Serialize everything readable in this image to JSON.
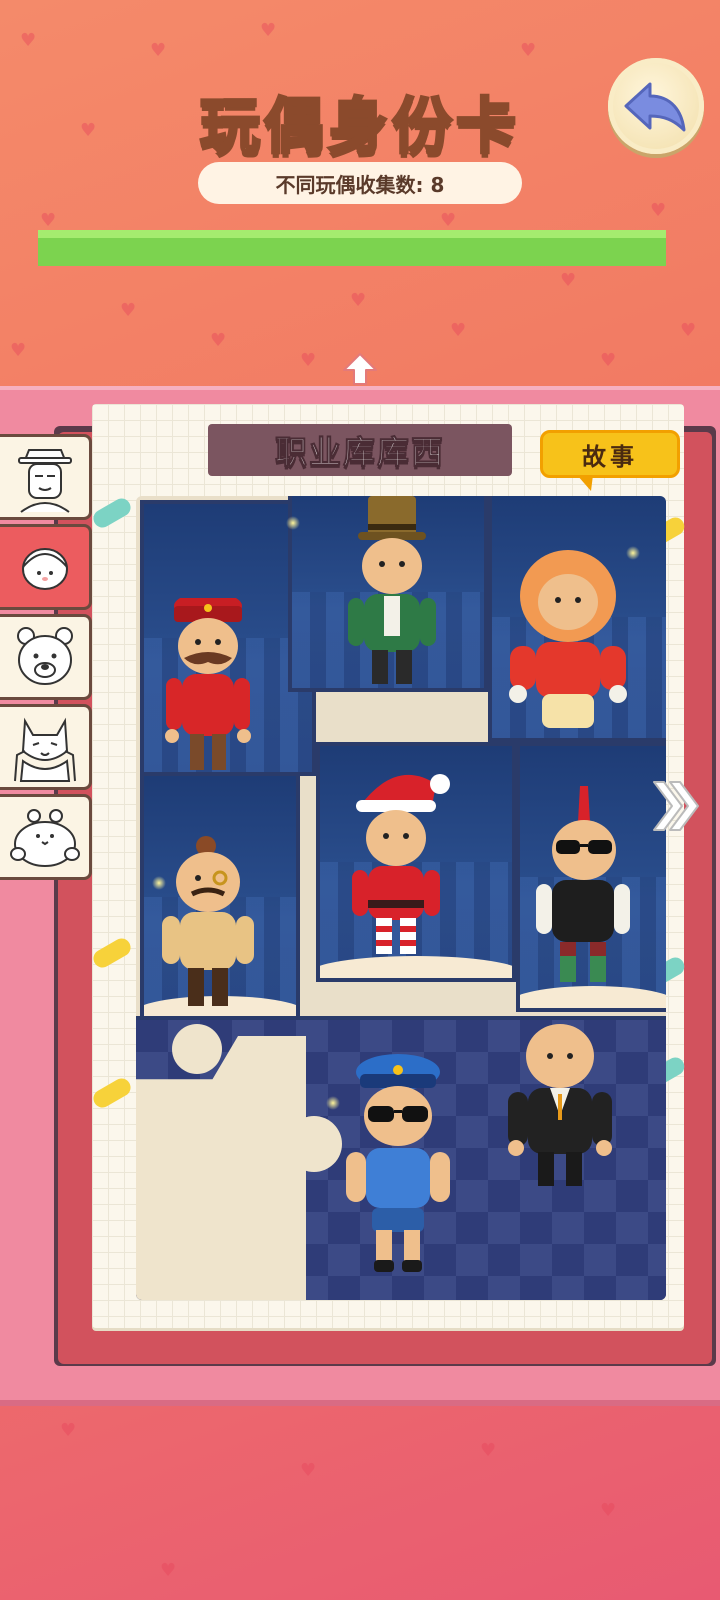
{
  "header": {
    "title_part1": "玩偶",
    "title_part2": "身份卡",
    "collection_label": "不同玩偶收集数: 8",
    "progress_fraction": 1.0
  },
  "card": {
    "name": "职业库库西",
    "story_button": "故事"
  },
  "side_tabs": [
    {
      "icon": "old-man-icon",
      "active": false
    },
    {
      "icon": "bald-head-icon",
      "active": true
    },
    {
      "icon": "polar-bear-icon",
      "active": false
    },
    {
      "icon": "cat-icon",
      "active": false
    },
    {
      "icon": "hamster-icon",
      "active": false
    }
  ],
  "dolls": [
    {
      "id": "conductor",
      "hat": "#c81e24",
      "body": "#d82628"
    },
    {
      "id": "top-hat-gentleman",
      "hat": "#8a6a2c",
      "body": "#2e7a46"
    },
    {
      "id": "astronaut",
      "hat": "#f29a52",
      "body": "#e4382c"
    },
    {
      "id": "monocle-gentleman",
      "hat": "#8a4a26",
      "body": "#e8c384"
    },
    {
      "id": "santa",
      "hat": "#d8222a",
      "body": "#d8222a"
    },
    {
      "id": "punk",
      "hat": "#d8222a",
      "body": "#1e1e1e"
    },
    {
      "id": "police",
      "hat": "#2c6ec8",
      "body": "#3f7fd6"
    },
    {
      "id": "businessman",
      "hat": "none",
      "body": "#222222"
    }
  ],
  "colors": {
    "progress_green": "#7cd34f",
    "banner": "#7b5560",
    "story": "#f7c21a",
    "active_tab": "#ec5c5f"
  }
}
